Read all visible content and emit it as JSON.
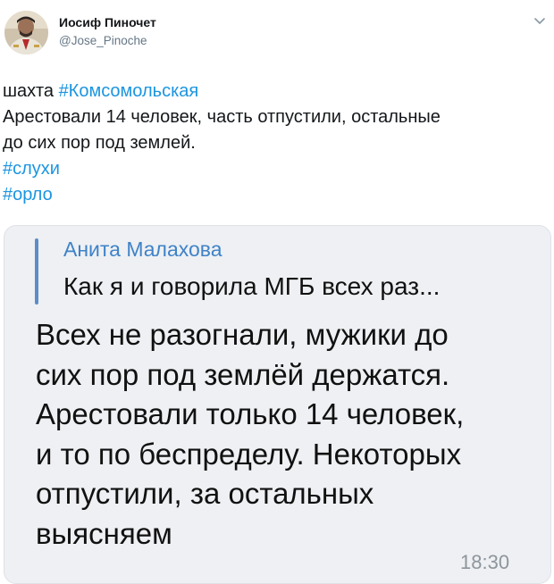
{
  "author": {
    "name": "Иосиф Пиночет",
    "handle": "@Jose_Pinoche",
    "avatar_icon": "avatar-portrait-icon"
  },
  "tweet": {
    "line1_prefix": "шахта ",
    "line1_hashtag": "#Комсомольская",
    "line2": "Арестовали 14 человек, часть отпустили, остальные",
    "line3": "до сих пор под землей.",
    "hashtag2": "#слухи",
    "hashtag3": "#орло"
  },
  "screenshot": {
    "reply_author": "Анита Малахова",
    "reply_text": "Как я и говорила МГБ всех раз...",
    "message_lines": [
      "Всех не разогнали, мужики до",
      "сих пор под землёй держатся.",
      "Арестовали только 14 человек,",
      "и то по беспределу. Некоторых",
      "отпустили, за остальных",
      "выясняем"
    ],
    "time": "18:30"
  },
  "colors": {
    "link": "#1b95e0",
    "reply_accent": "#3f82c8",
    "bubble_bg": "#eef0f3"
  }
}
